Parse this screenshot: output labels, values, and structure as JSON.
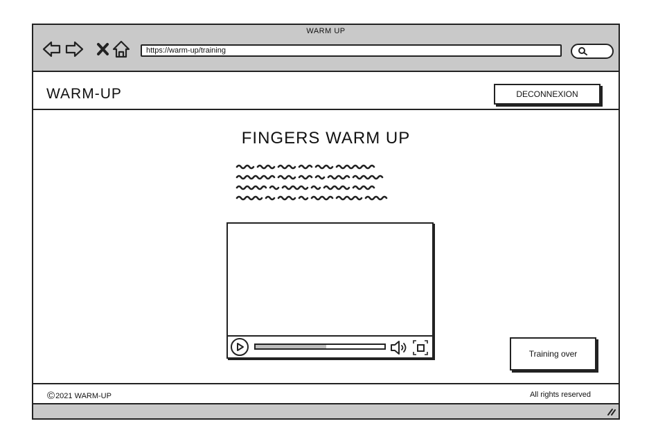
{
  "browser": {
    "window_title": "WARM UP",
    "url": "https://warm-up/training",
    "icons": [
      "back-arrow-icon",
      "forward-arrow-icon",
      "stop-icon",
      "home-icon",
      "search-icon"
    ]
  },
  "header": {
    "brand": "WARM-UP",
    "logout_label": "DECONNEXION"
  },
  "main": {
    "title": "FINGERS WARM UP",
    "video": {
      "progress": 0.55,
      "icons": [
        "play-icon",
        "volume-icon",
        "fullscreen-icon"
      ]
    },
    "done_label": "Training over"
  },
  "footer": {
    "copyright_symbol": "©",
    "copyright_text": "2021 WARM-UP",
    "rights": "All rights reserved"
  },
  "colors": {
    "chrome": "#c9c9c9",
    "stroke": "#222222",
    "progress_fill": "#bdbdbd"
  }
}
